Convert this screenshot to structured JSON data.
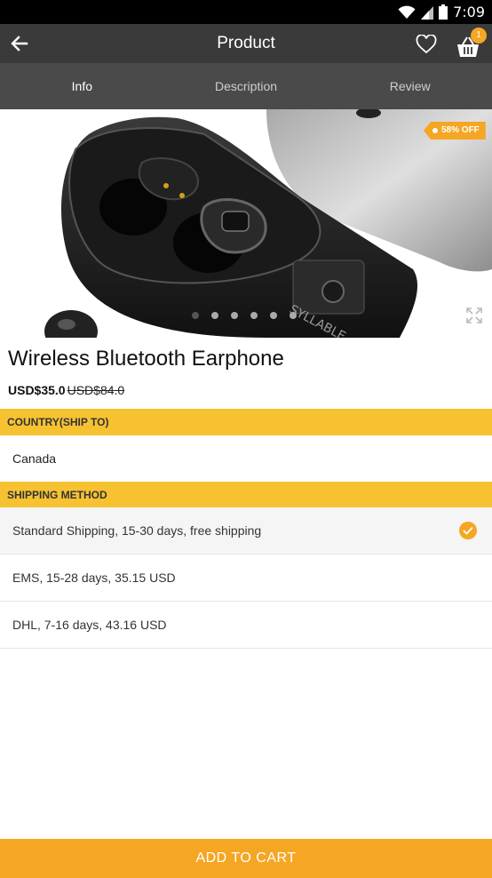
{
  "status_bar": {
    "time": "7:09"
  },
  "app_bar": {
    "title": "Product",
    "cart_count": "1"
  },
  "tabs": [
    {
      "label": "Info",
      "active": true
    },
    {
      "label": "Description",
      "active": false
    },
    {
      "label": "Review",
      "active": false
    }
  ],
  "gallery": {
    "discount": "58% OFF",
    "image_count": 6,
    "current_index": 0,
    "product_brand_text": "SYLLABLE"
  },
  "product": {
    "name": "Wireless Bluetooth Earphone",
    "price": "USD$35.0",
    "original_price": "USD$84.0"
  },
  "country": {
    "header": "COUNTRY(SHIP TO)",
    "value": "Canada"
  },
  "shipping": {
    "header": "SHIPPING METHOD",
    "options": [
      {
        "label": "Standard Shipping, 15-30 days, free shipping",
        "selected": true
      },
      {
        "label": "EMS, 15-28 days, 35.15 USD",
        "selected": false
      },
      {
        "label": "DHL, 7-16 days, 43.16 USD",
        "selected": false
      }
    ]
  },
  "actions": {
    "add_to_cart": "ADD TO CART"
  },
  "colors": {
    "accent": "#f5a623",
    "section_header": "#f6c232",
    "app_bar": "#3a3a3a",
    "tab_bar": "#4a4a4a"
  }
}
